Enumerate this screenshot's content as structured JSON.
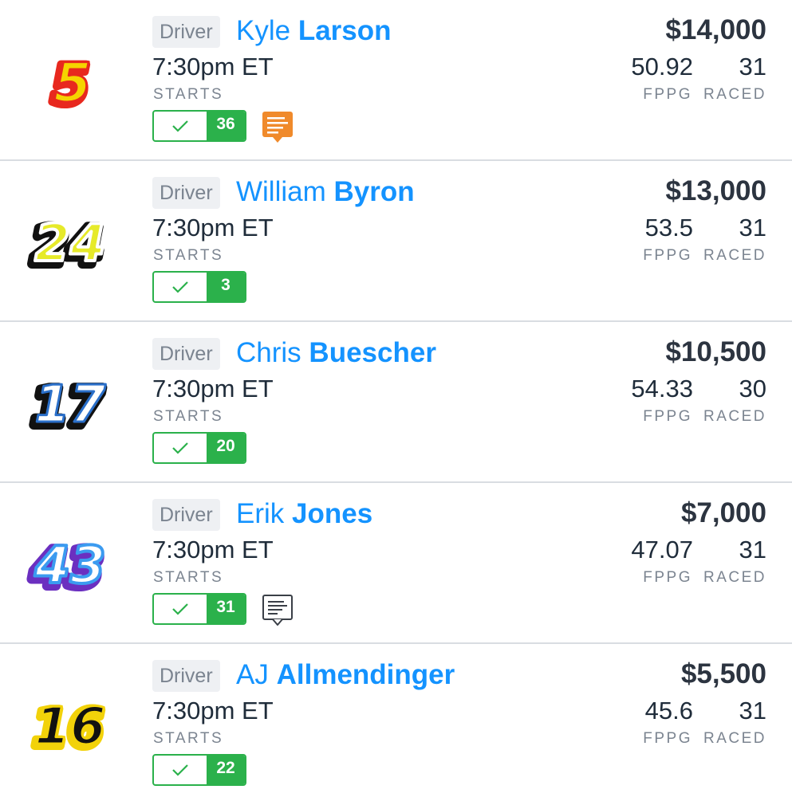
{
  "players": [
    {
      "car_number": "5",
      "car_colors": {
        "fill": "#f5d400",
        "stroke": "#e8281e",
        "shadow": "#e8281e"
      },
      "position": "Driver",
      "first_name": "Kyle",
      "last_name": "Larson",
      "time": "7:30pm ET",
      "starts_label": "STARTS",
      "starts_count": "36",
      "salary": "$14,000",
      "fppg": "50.92",
      "fppg_label": "FPPG",
      "raced": "31",
      "raced_label": "RACED",
      "note": "news-icon-orange"
    },
    {
      "car_number": "24",
      "car_colors": {
        "fill": "#e6ea2a",
        "stroke": "#ffffff",
        "shadow": "#111111"
      },
      "position": "Driver",
      "first_name": "William",
      "last_name": "Byron",
      "time": "7:30pm ET",
      "starts_label": "STARTS",
      "starts_count": "3",
      "salary": "$13,000",
      "fppg": "53.5",
      "fppg_label": "FPPG",
      "raced": "31",
      "raced_label": "RACED",
      "note": null
    },
    {
      "car_number": "17",
      "car_colors": {
        "fill": "#ffffff",
        "stroke": "#2a6fc9",
        "shadow": "#111111"
      },
      "position": "Driver",
      "first_name": "Chris",
      "last_name": "Buescher",
      "time": "7:30pm ET",
      "starts_label": "STARTS",
      "starts_count": "20",
      "salary": "$10,500",
      "fppg": "54.33",
      "fppg_label": "FPPG",
      "raced": "30",
      "raced_label": "RACED",
      "note": null
    },
    {
      "car_number": "43",
      "car_colors": {
        "fill": "#ffffff",
        "stroke": "#3b9bf0",
        "shadow": "#6b2fc0"
      },
      "position": "Driver",
      "first_name": "Erik",
      "last_name": "Jones",
      "time": "7:30pm ET",
      "starts_label": "STARTS",
      "starts_count": "31",
      "salary": "$7,000",
      "fppg": "47.07",
      "fppg_label": "FPPG",
      "raced": "31",
      "raced_label": "RACED",
      "note": "news-icon-outline"
    },
    {
      "car_number": "16",
      "car_colors": {
        "fill": "#111111",
        "stroke": "#f2d20a",
        "shadow": "#f2d20a"
      },
      "position": "Driver",
      "first_name": "AJ",
      "last_name": "Allmendinger",
      "time": "7:30pm ET",
      "starts_label": "STARTS",
      "starts_count": "22",
      "salary": "$5,500",
      "fppg": "45.6",
      "fppg_label": "FPPG",
      "raced": "31",
      "raced_label": "RACED",
      "note": null
    }
  ],
  "colors": {
    "accent_blue": "#1493ff",
    "starts_green": "#2bb14b",
    "news_orange": "#f08a2b",
    "divider": "#d9dde2"
  }
}
